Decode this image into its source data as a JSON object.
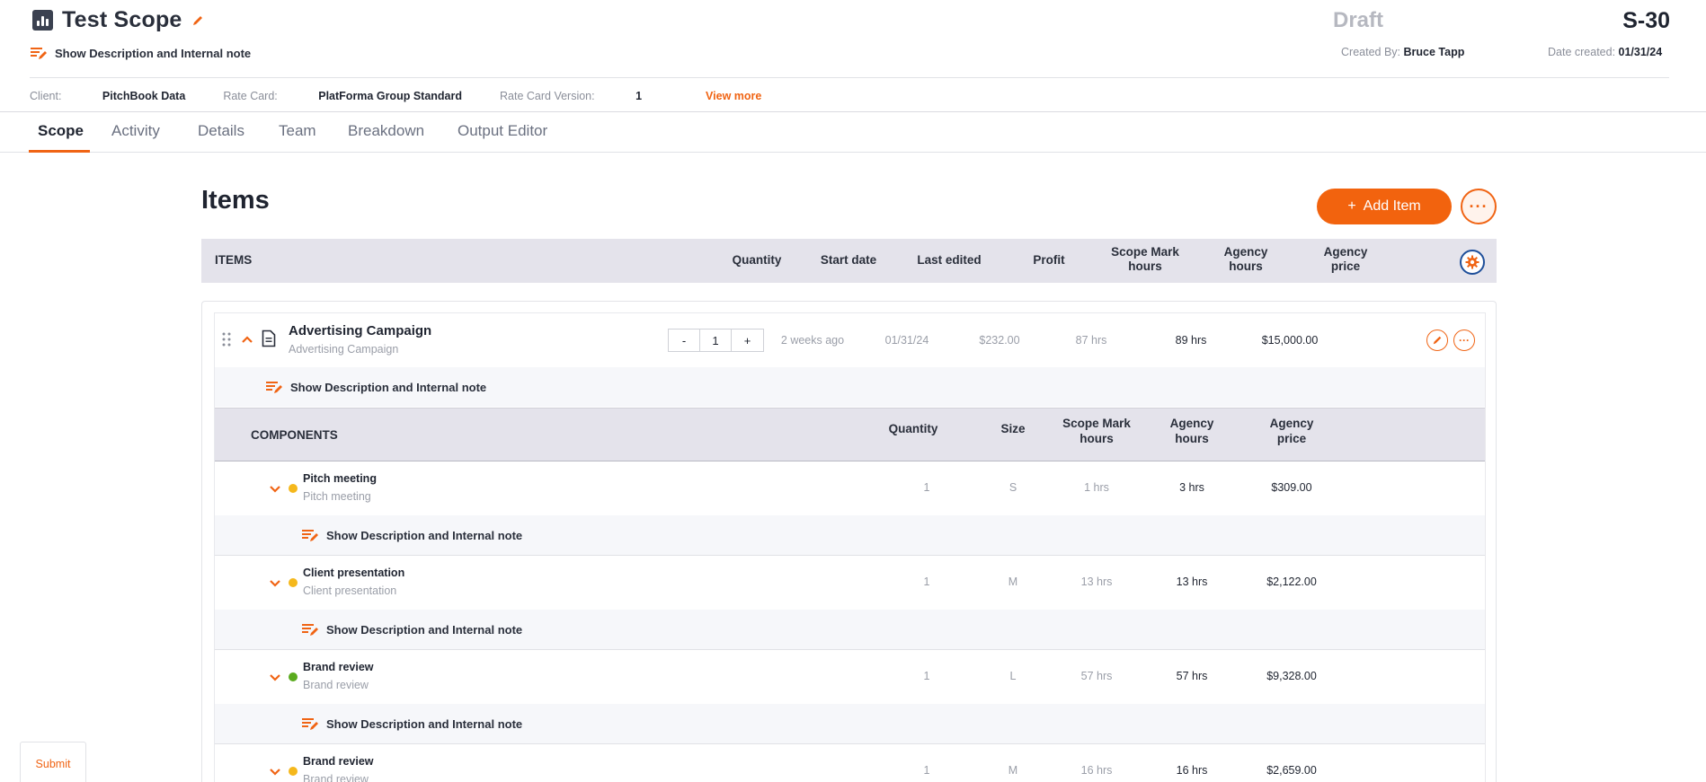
{
  "header": {
    "title": "Test Scope",
    "desc_toggle": "Show Description and Internal note",
    "status": "Draft",
    "scope_id": "S-30",
    "created_by_label": "Created By:",
    "created_by": "Bruce Tapp",
    "date_created_label": "Date created:",
    "date_created": "01/31/24"
  },
  "info": {
    "client_label": "Client:",
    "client": "PitchBook Data",
    "rate_card_label": "Rate Card:",
    "rate_card": "PlatForma Group Standard",
    "rate_card_version_label": "Rate Card Version:",
    "rate_card_version": "1",
    "view_more": "View more"
  },
  "tabs": [
    "Scope",
    "Activity",
    "Details",
    "Team",
    "Breakdown",
    "Output Editor"
  ],
  "items_section": {
    "title": "Items",
    "add_item_label": "Add Item",
    "add_item_plus": "+",
    "more_label": "···",
    "columns": {
      "items": "ITEMS",
      "quantity": "Quantity",
      "start_date": "Start date",
      "last_edited": "Last edited",
      "profit": "Profit",
      "scope_mark_hours_1": "Scope Mark",
      "scope_mark_hours_2": "hours",
      "agency_hours_1": "Agency",
      "agency_hours_2": "hours",
      "agency_price_1": "Agency",
      "agency_price_2": "price"
    }
  },
  "item": {
    "name": "Advertising Campaign",
    "subtitle": "Advertising Campaign",
    "qty_minus": "-",
    "quantity": "1",
    "qty_plus": "+",
    "start_date": "2 weeks ago",
    "last_edited": "01/31/24",
    "profit": "$232.00",
    "scope_mark_hours": "87 hrs",
    "agency_hours": "89 hrs",
    "agency_price": "$15,000.00",
    "more_label": "···",
    "desc_toggle": "Show Description and Internal note"
  },
  "components": {
    "header": {
      "title": "COMPONENTS",
      "quantity": "Quantity",
      "size": "Size",
      "scope_mark_1": "Scope Mark",
      "scope_mark_2": "hours",
      "agency_hours_1": "Agency",
      "agency_hours_2": "hours",
      "agency_price_1": "Agency",
      "agency_price_2": "price"
    },
    "rows": [
      {
        "name": "Pitch meeting",
        "subtitle": "Pitch meeting",
        "quantity": "1",
        "size": "S",
        "scope_mark_hours": "1 hrs",
        "agency_hours": "3 hrs",
        "agency_price": "$309.00",
        "dot_color": "#f5b81c",
        "desc_toggle": "Show Description and Internal note"
      },
      {
        "name": "Client presentation",
        "subtitle": "Client presentation",
        "quantity": "1",
        "size": "M",
        "scope_mark_hours": "13 hrs",
        "agency_hours": "13 hrs",
        "agency_price": "$2,122.00",
        "dot_color": "#f5b81c",
        "desc_toggle": "Show Description and Internal note"
      },
      {
        "name": "Brand review",
        "subtitle": "Brand review",
        "quantity": "1",
        "size": "L",
        "scope_mark_hours": "57 hrs",
        "agency_hours": "57 hrs",
        "agency_price": "$9,328.00",
        "dot_color": "#5aab1e",
        "desc_toggle": "Show Description and Internal note"
      },
      {
        "name": "Brand review",
        "subtitle": "Brand review",
        "quantity": "1",
        "size": "M",
        "scope_mark_hours": "16 hrs",
        "agency_hours": "16 hrs",
        "agency_price": "$2,659.00",
        "dot_color": "#f5b81c"
      }
    ]
  },
  "submit_label": "Submit",
  "colors": {
    "accent": "#f06414",
    "header_band": "#e4e3eb",
    "gear_ring": "#1e4f9a"
  }
}
